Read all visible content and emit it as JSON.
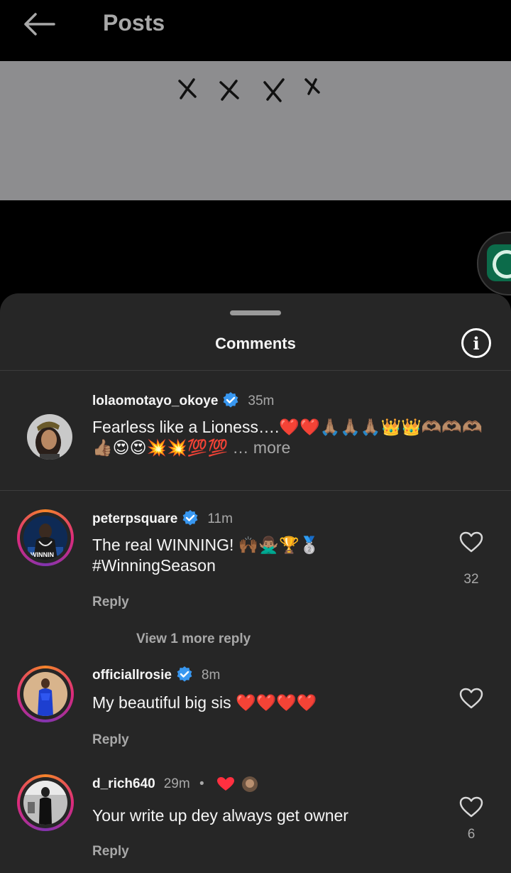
{
  "header": {
    "title": "Posts"
  },
  "comments_sheet": {
    "title": "Comments",
    "comments": [
      {
        "username": "lolaomotayo_okoye",
        "time": "35m",
        "text": "Fearless like a Lioness….❤️❤️🙏🏽🙏🏽🙏🏽👑👑🫶🏽🫶🏽🫶🏽👍🏽😍😍💥💥💯💯",
        "more": " … more"
      },
      {
        "username": "peterpsquare",
        "time": "11m",
        "text": "The real WINNING! 🙌🏾🙅🏽‍♂️🏆🥈",
        "hashtag": "#WinningSeason",
        "reply": "Reply",
        "likes": "32",
        "view_replies": "View 1 more reply"
      },
      {
        "username": "officiallrosie",
        "time": "8m",
        "text": "My beautiful big sis ❤️❤️❤️❤️",
        "reply": "Reply"
      },
      {
        "username": "d_rich640",
        "time": "29m",
        "dot": "•",
        "text": "Your write up dey always get owner",
        "reply": "Reply",
        "likes": "6"
      }
    ]
  },
  "colors": {
    "accent_verified": "#3897f0",
    "sheet_bg": "#262626",
    "post_bg": "#8d8d8f"
  },
  "icons": [
    "back-arrow-icon",
    "info-icon",
    "verified-badge-icon",
    "heart-icon",
    "whatsapp-icon"
  ]
}
